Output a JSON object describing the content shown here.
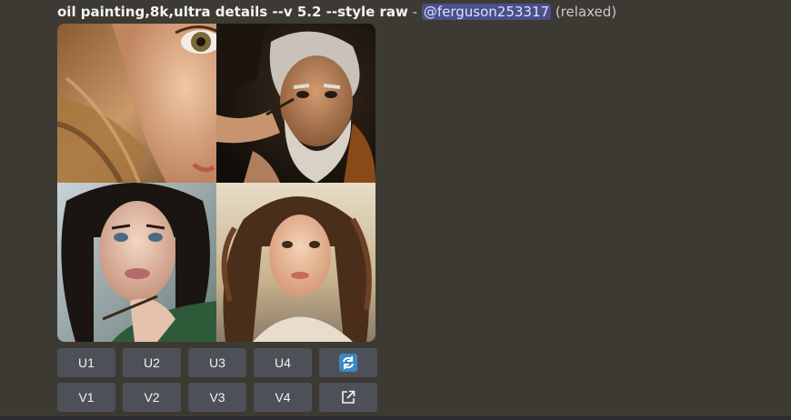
{
  "message": {
    "prompt": "oil painting,8k,ultra details --v 5.2 --style raw",
    "separator": " - ",
    "mention": "@ferguson253317",
    "mode": " (relaxed)"
  },
  "images": [
    {
      "name": "woman-eye-closeup"
    },
    {
      "name": "old-man-portrait"
    },
    {
      "name": "dark-haired-woman-brush"
    },
    {
      "name": "woman-windblown-hair"
    }
  ],
  "buttons": {
    "upscale": [
      "U1",
      "U2",
      "U3",
      "U4"
    ],
    "variation": [
      "V1",
      "V2",
      "V3",
      "V4"
    ],
    "reroll_icon": "refresh-icon",
    "open_icon": "open-external-icon"
  },
  "colors": {
    "background": "#3d3a33",
    "button": "#4e5058",
    "mention_bg": "#4b4f8a",
    "reroll_blue": "#3b88c3"
  }
}
